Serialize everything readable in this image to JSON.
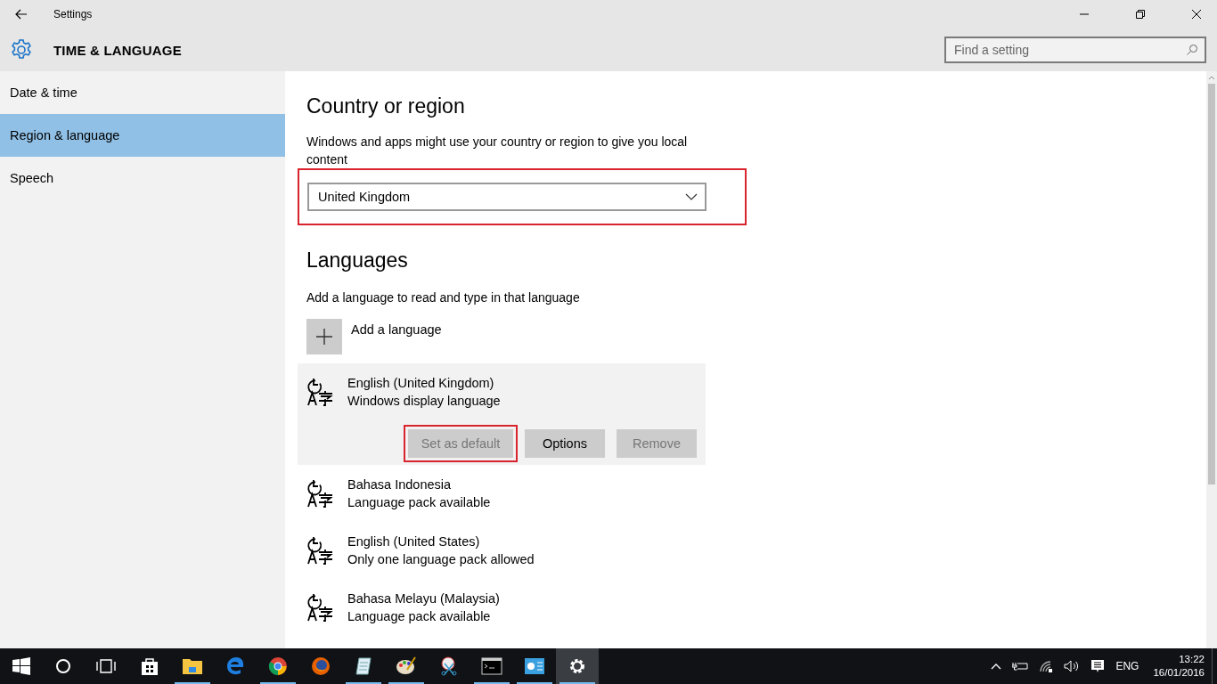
{
  "window": {
    "title": "Settings"
  },
  "header": {
    "title": "TIME & LANGUAGE",
    "search": {
      "placeholder": "Find a setting"
    }
  },
  "sidebar": {
    "items": [
      {
        "label": "Date & time",
        "selected": false
      },
      {
        "label": "Region & language",
        "selected": true
      },
      {
        "label": "Speech",
        "selected": false
      }
    ]
  },
  "country": {
    "heading": "Country or region",
    "description": "Windows and apps might use your country or region to give you local content",
    "dropdown": {
      "value": "United Kingdom",
      "highlighted": true
    }
  },
  "languages": {
    "heading": "Languages",
    "description": "Add a language to read and type in that language",
    "add_label": "Add a language",
    "items": [
      {
        "name": "English (United Kingdom)",
        "status": "Windows display language",
        "selected": true,
        "buttons": [
          {
            "label": "Set as default",
            "disabled": true,
            "highlighted": true
          },
          {
            "label": "Options",
            "disabled": false,
            "highlighted": false
          },
          {
            "label": "Remove",
            "disabled": true,
            "highlighted": false
          }
        ]
      },
      {
        "name": "Bahasa Indonesia",
        "status": "Language pack available",
        "selected": false
      },
      {
        "name": "English (United States)",
        "status": "Only one language pack allowed",
        "selected": false
      },
      {
        "name": "Bahasa Melayu (Malaysia)",
        "status": "Language pack available",
        "selected": false
      }
    ]
  },
  "taskbar": {
    "apps": [
      {
        "kind": "store",
        "running": false,
        "active": false
      },
      {
        "kind": "explorer",
        "running": true,
        "active": false
      },
      {
        "kind": "edge",
        "running": false,
        "active": false
      },
      {
        "kind": "chrome",
        "running": true,
        "active": false
      },
      {
        "kind": "firefox",
        "running": false,
        "active": false
      },
      {
        "kind": "notepad",
        "running": true,
        "active": false
      },
      {
        "kind": "paint",
        "running": true,
        "active": false
      },
      {
        "kind": "snipping",
        "running": false,
        "active": false
      },
      {
        "kind": "console",
        "running": true,
        "active": false
      },
      {
        "kind": "chart",
        "running": true,
        "active": false
      },
      {
        "kind": "settings",
        "running": true,
        "active": true
      }
    ],
    "language": "ENG",
    "time": "13:22",
    "date": "16/01/2016"
  }
}
